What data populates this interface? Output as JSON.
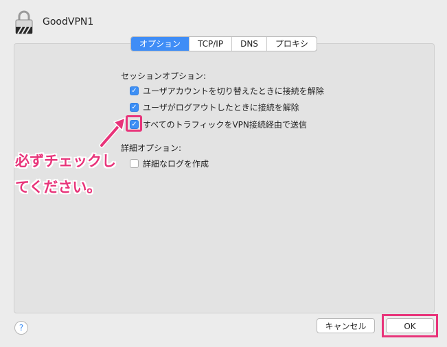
{
  "window": {
    "title": "GoodVPN1",
    "icon": "lock-icon"
  },
  "tabs": [
    {
      "label": "オプション",
      "active": true
    },
    {
      "label": "TCP/IP",
      "active": false
    },
    {
      "label": "DNS",
      "active": false
    },
    {
      "label": "プロキシ",
      "active": false
    }
  ],
  "session": {
    "title": "セッションオプション:",
    "options": [
      {
        "label": "ユーザアカウントを切り替えたときに接続を解除",
        "checked": true
      },
      {
        "label": "ユーザがログアウトしたときに接続を解除",
        "checked": true
      },
      {
        "label": "すべてのトラフィックをVPN接続経由で送信",
        "checked": true
      }
    ]
  },
  "advanced": {
    "title": "詳細オプション:",
    "options": [
      {
        "label": "詳細なログを作成",
        "checked": false
      }
    ]
  },
  "annotation": {
    "line1": "必ずチェックし",
    "line2": "てください。",
    "color": "#e8347a"
  },
  "footer": {
    "help": "?",
    "cancel_label": "キャンセル",
    "ok_label": "OK"
  },
  "colors": {
    "accent": "#3f8df6",
    "highlight": "#e8347a"
  }
}
